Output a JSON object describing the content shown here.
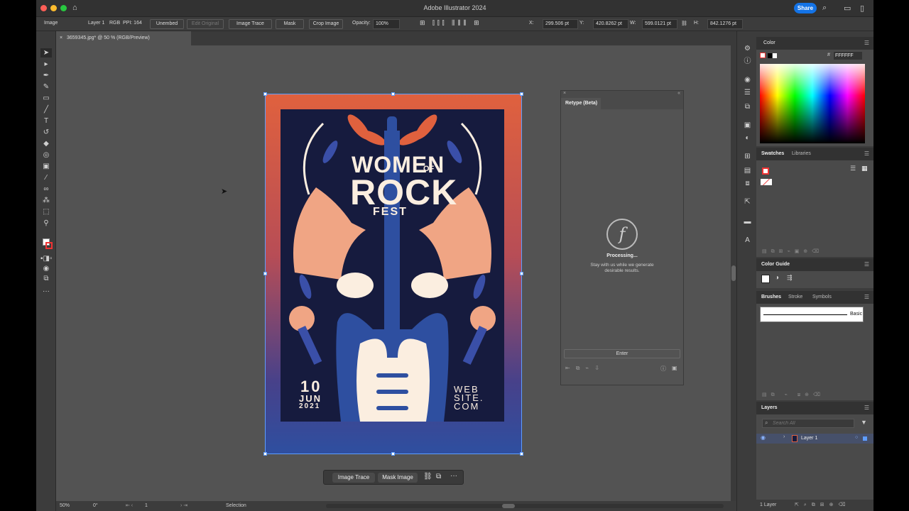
{
  "app": {
    "title": "Adobe Illustrator 2024",
    "share": "Share"
  },
  "control": {
    "object_type": "Image",
    "layer": "Layer 1",
    "color_mode": "RGB",
    "ppi": "PPI: 164",
    "unembed": "Unembed",
    "edit_original": "Edit Original",
    "image_trace": "Image Trace",
    "mask": "Mask",
    "crop_image": "Crop Image",
    "opacity_label": "Opacity:",
    "opacity_value": "100%",
    "x_label": "X:",
    "x_value": "299.506 pt",
    "y_label": "Y:",
    "y_value": "420.8262 pt",
    "w_label": "W:",
    "w_value": "599.0121 pt",
    "h_label": "H:",
    "h_value": "842.1276 pt"
  },
  "document": {
    "tab": "3659345.jpg* @ 50 % (RGB/Preview)"
  },
  "poster": {
    "line1": "WOMEN",
    "line1_small": "OF",
    "line2": "ROCK",
    "line3": "FEST",
    "date_day": "10",
    "date_month": "JUN",
    "date_year": "2021",
    "web1": "WEB",
    "web2": "SITE.",
    "web3": "COM",
    "colors": {
      "orange": "#e0613e",
      "navy": "#161b3e",
      "blue": "#2e4fa0",
      "skin": "#f0a584",
      "cream": "#fbeee0"
    }
  },
  "context_bar": {
    "image_trace": "Image Trace",
    "mask_image": "Mask Image"
  },
  "retype": {
    "tab": "Retype (Beta)",
    "status": "Processing...",
    "message_line1": "Stay with us while we generate",
    "message_line2": "desirable results.",
    "enter": "Enter"
  },
  "color_panel": {
    "title": "Color",
    "hex": "FFFFFF"
  },
  "swatches_panel": {
    "tabs": [
      "Swatches",
      "Libraries"
    ]
  },
  "color_guide": {
    "title": "Color Guide"
  },
  "brushes_panel": {
    "tabs": [
      "Brushes",
      "Stroke",
      "Symbols"
    ],
    "brush_name": "Basic"
  },
  "layers_panel": {
    "title": "Layers",
    "search_placeholder": "Search All",
    "layer_name": "Layer 1",
    "footer": "1 Layer"
  },
  "status_bar": {
    "zoom": "50%",
    "rotation": "0°",
    "artboard": "1",
    "tool": "Selection"
  }
}
